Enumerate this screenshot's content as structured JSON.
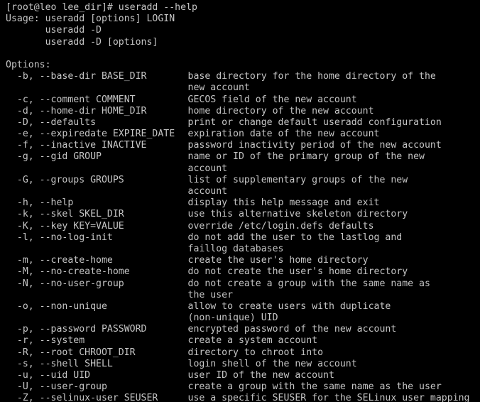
{
  "terminal": {
    "colors": {
      "background": "#000000",
      "foreground": "#c5c5c5"
    },
    "prompt_line": "[root@leo lee_dir]# useradd --help",
    "usage": [
      "Usage: useradd [options] LOGIN",
      "       useradd -D",
      "       useradd -D [options]"
    ],
    "blank_line": "",
    "options_heading": "Options:",
    "options": [
      {
        "flags": "  -b, --base-dir BASE_DIR",
        "description": [
          "base directory for the home directory of the",
          "new account"
        ]
      },
      {
        "flags": "  -c, --comment COMMENT",
        "description": [
          "GECOS field of the new account"
        ]
      },
      {
        "flags": "  -d, --home-dir HOME_DIR",
        "description": [
          "home directory of the new account"
        ]
      },
      {
        "flags": "  -D, --defaults",
        "description": [
          "print or change default useradd configuration"
        ]
      },
      {
        "flags": "  -e, --expiredate EXPIRE_DATE",
        "description": [
          "expiration date of the new account"
        ]
      },
      {
        "flags": "  -f, --inactive INACTIVE",
        "description": [
          "password inactivity period of the new account"
        ]
      },
      {
        "flags": "  -g, --gid GROUP",
        "description": [
          "name or ID of the primary group of the new",
          "account"
        ]
      },
      {
        "flags": "  -G, --groups GROUPS",
        "description": [
          "list of supplementary groups of the new",
          "account"
        ]
      },
      {
        "flags": "  -h, --help",
        "description": [
          "display this help message and exit"
        ]
      },
      {
        "flags": "  -k, --skel SKEL_DIR",
        "description": [
          "use this alternative skeleton directory"
        ]
      },
      {
        "flags": "  -K, --key KEY=VALUE",
        "description": [
          "override /etc/login.defs defaults"
        ]
      },
      {
        "flags": "  -l, --no-log-init",
        "description": [
          "do not add the user to the lastlog and",
          "faillog databases"
        ]
      },
      {
        "flags": "  -m, --create-home",
        "description": [
          "create the user's home directory"
        ]
      },
      {
        "flags": "  -M, --no-create-home",
        "description": [
          "do not create the user's home directory"
        ]
      },
      {
        "flags": "  -N, --no-user-group",
        "description": [
          "do not create a group with the same name as",
          "the user"
        ]
      },
      {
        "flags": "  -o, --non-unique",
        "description": [
          "allow to create users with duplicate",
          "(non-unique) UID"
        ]
      },
      {
        "flags": "  -p, --password PASSWORD",
        "description": [
          "encrypted password of the new account"
        ]
      },
      {
        "flags": "  -r, --system",
        "description": [
          "create a system account"
        ]
      },
      {
        "flags": "  -R, --root CHROOT_DIR",
        "description": [
          "directory to chroot into"
        ]
      },
      {
        "flags": "  -s, --shell SHELL",
        "description": [
          "login shell of the new account"
        ]
      },
      {
        "flags": "  -u, --uid UID",
        "description": [
          "user ID of the new account"
        ]
      },
      {
        "flags": "  -U, --user-group",
        "description": [
          "create a group with the same name as the user"
        ]
      },
      {
        "flags": "  -Z, --selinux-user SEUSER",
        "description": [
          "use a specific SEUSER for the SELinux user mapping"
        ]
      }
    ]
  }
}
